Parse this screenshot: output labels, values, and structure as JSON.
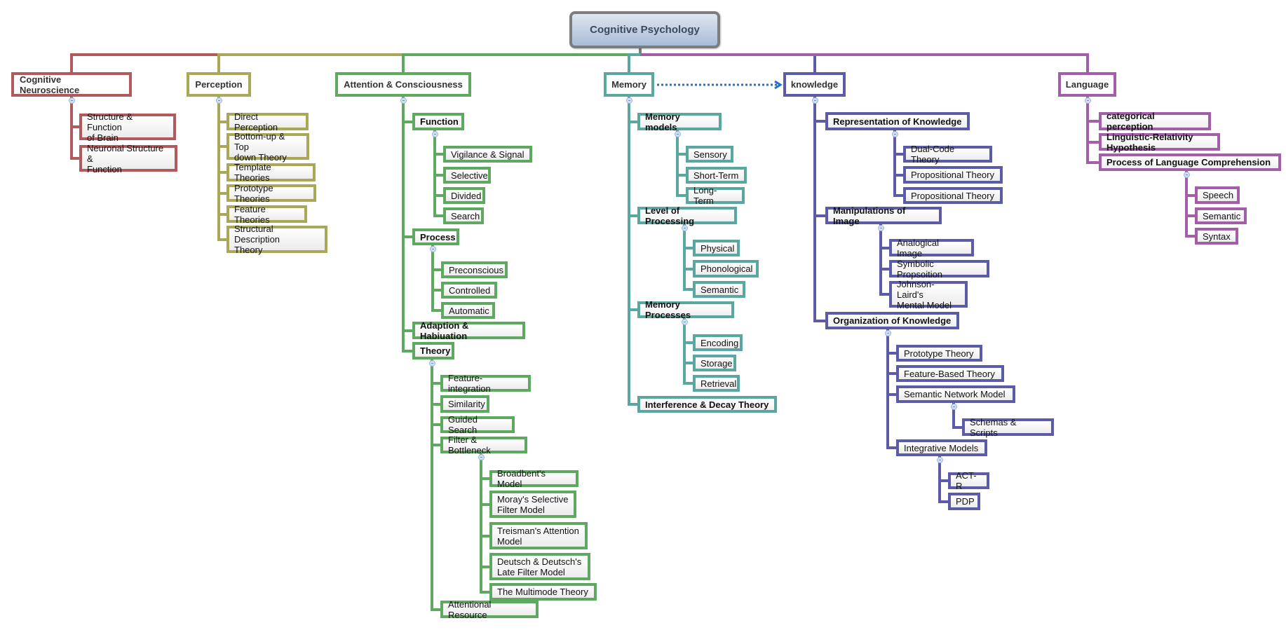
{
  "root": {
    "id": "root",
    "label": "Cognitive Psychology"
  },
  "relationship": {
    "from": "memory",
    "to": "knowledge",
    "style": "dotted-arrow",
    "color": "#1f6fd1"
  },
  "branches": [
    {
      "id": "cogneuro",
      "label": "Cognitive Neuroscience",
      "color": "#b15a5e",
      "children": [
        {
          "id": "cn1",
          "label": "Structure & Function\nof Brain"
        },
        {
          "id": "cn2",
          "label": "Neuronal Structure &\nFunction"
        }
      ]
    },
    {
      "id": "perception",
      "label": "Perception",
      "color": "#a9a859",
      "children": [
        {
          "id": "p1",
          "label": "Direct Perception"
        },
        {
          "id": "p2",
          "label": "Bottom-up & Top\ndown Theory"
        },
        {
          "id": "p3",
          "label": "Template Theories"
        },
        {
          "id": "p4",
          "label": "Prototype Theories"
        },
        {
          "id": "p5",
          "label": "Feature Theories"
        },
        {
          "id": "p6",
          "label": "Structural Description\nTheory"
        }
      ]
    },
    {
      "id": "attention",
      "label": "Attention & Consciousness",
      "color": "#5fa85f",
      "children": [
        {
          "id": "a1",
          "label": "Function",
          "children": [
            {
              "id": "a1a",
              "label": "Vigilance & Signal"
            },
            {
              "id": "a1b",
              "label": "Selective"
            },
            {
              "id": "a1c",
              "label": "Divided"
            },
            {
              "id": "a1d",
              "label": "Search"
            }
          ]
        },
        {
          "id": "a2",
          "label": "Process",
          "children": [
            {
              "id": "a2a",
              "label": "Preconscious"
            },
            {
              "id": "a2b",
              "label": "Controlled"
            },
            {
              "id": "a2c",
              "label": "Automatic"
            }
          ]
        },
        {
          "id": "a3",
          "label": "Adaption & Habiuation"
        },
        {
          "id": "a4",
          "label": "Theory",
          "children": [
            {
              "id": "a4a",
              "label": "Feature-integration"
            },
            {
              "id": "a4b",
              "label": "Similarity"
            },
            {
              "id": "a4c",
              "label": "Guided Search"
            },
            {
              "id": "a4d",
              "label": "Filter & Bottleneck",
              "children": [
                {
                  "id": "a4d1",
                  "label": "Broadbent's Model"
                },
                {
                  "id": "a4d2",
                  "label": "Moray's Selective\nFilter Model"
                },
                {
                  "id": "a4d3",
                  "label": "Treisman's Attention\nModel"
                },
                {
                  "id": "a4d4",
                  "label": "Deutsch & Deutsch's\nLate Filter Model"
                },
                {
                  "id": "a4d5",
                  "label": "The Multimode Theory"
                }
              ]
            },
            {
              "id": "a4e",
              "label": "Attentional Resource"
            }
          ]
        }
      ]
    },
    {
      "id": "memory",
      "label": "Memory",
      "color": "#5aa7a0",
      "children": [
        {
          "id": "m1",
          "label": "Memory models",
          "children": [
            {
              "id": "m1a",
              "label": "Sensory"
            },
            {
              "id": "m1b",
              "label": "Short-Term"
            },
            {
              "id": "m1c",
              "label": "Long-Term"
            }
          ]
        },
        {
          "id": "m2",
          "label": "Level of Processing",
          "children": [
            {
              "id": "m2a",
              "label": "Physical"
            },
            {
              "id": "m2b",
              "label": "Phonological"
            },
            {
              "id": "m2c",
              "label": "Semantic"
            }
          ]
        },
        {
          "id": "m3",
          "label": "Memory Processes",
          "children": [
            {
              "id": "m3a",
              "label": "Encoding"
            },
            {
              "id": "m3b",
              "label": "Storage"
            },
            {
              "id": "m3c",
              "label": "Retrieval"
            }
          ]
        },
        {
          "id": "m4",
          "label": "Interference & Decay Theory"
        }
      ]
    },
    {
      "id": "knowledge",
      "label": "knowledge",
      "color": "#5c5ba8",
      "children": [
        {
          "id": "k1",
          "label": "Representation of Knowledge",
          "children": [
            {
              "id": "k1a",
              "label": "Dual-Code Theory"
            },
            {
              "id": "k1b",
              "label": "Propositional Theory"
            },
            {
              "id": "k1c",
              "label": "Propositional Theory"
            }
          ]
        },
        {
          "id": "k2",
          "label": "Manipulations of Image",
          "children": [
            {
              "id": "k2a",
              "label": "Analogical Image"
            },
            {
              "id": "k2b",
              "label": "Symbolic Propsoition"
            },
            {
              "id": "k2c",
              "label": "Johnson-Laird's\nMental Model"
            }
          ]
        },
        {
          "id": "k3",
          "label": "Organization of Knowledge",
          "children": [
            {
              "id": "k3a",
              "label": "Prototype Theory"
            },
            {
              "id": "k3b",
              "label": "Feature-Based Theory"
            },
            {
              "id": "k3c",
              "label": "Semantic Network Model",
              "children": [
                {
                  "id": "k3c1",
                  "label": "Schemas & Scripts"
                }
              ]
            },
            {
              "id": "k3d",
              "label": "Integrative Models",
              "children": [
                {
                  "id": "k3d1",
                  "label": "ACT-R"
                },
                {
                  "id": "k3d2",
                  "label": "PDP"
                }
              ]
            }
          ]
        }
      ]
    },
    {
      "id": "language",
      "label": "Language",
      "color": "#a45ea8",
      "children": [
        {
          "id": "l1",
          "label": "categorical perception"
        },
        {
          "id": "l2",
          "label": "Linguistic-Relativity Hypothesis"
        },
        {
          "id": "l3",
          "label": "Process of Language Comprehension",
          "children": [
            {
              "id": "l3a",
              "label": "Speech"
            },
            {
              "id": "l3b",
              "label": "Semantic"
            },
            {
              "id": "l3c",
              "label": "Syntax"
            }
          ]
        }
      ]
    }
  ]
}
